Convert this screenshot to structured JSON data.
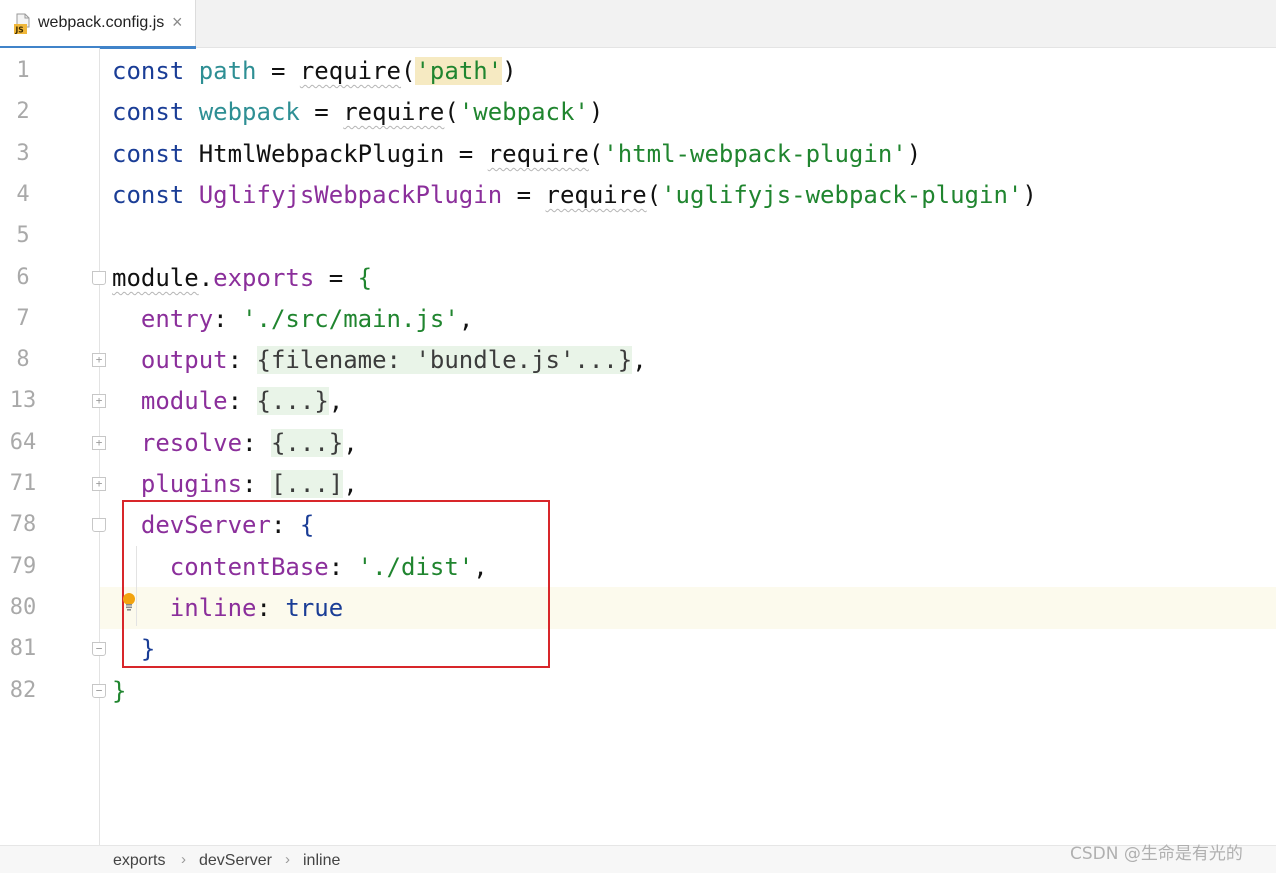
{
  "tab": {
    "filename": "webpack.config.js",
    "close_glyph": "×",
    "icon": "js-file-icon"
  },
  "lines": [
    {
      "no": "1",
      "tokens": [
        [
          "const",
          "kw"
        ],
        [
          " ",
          "plain"
        ],
        [
          "path",
          "var"
        ],
        [
          " = ",
          "plain"
        ],
        [
          "require",
          "req"
        ],
        [
          "(",
          "plain"
        ],
        [
          "'path'",
          "str-hl"
        ],
        [
          ")",
          "plain"
        ]
      ]
    },
    {
      "no": "2",
      "tokens": [
        [
          "const",
          "kw"
        ],
        [
          " ",
          "plain"
        ],
        [
          "webpack",
          "var"
        ],
        [
          " = ",
          "plain"
        ],
        [
          "require",
          "req"
        ],
        [
          "(",
          "plain"
        ],
        [
          "'webpack'",
          "str"
        ],
        [
          ")",
          "plain"
        ]
      ]
    },
    {
      "no": "3",
      "tokens": [
        [
          "const",
          "kw"
        ],
        [
          " HtmlWebpackPlugin = ",
          "plain"
        ],
        [
          "require",
          "req"
        ],
        [
          "(",
          "plain"
        ],
        [
          "'html-webpack-plugin'",
          "str"
        ],
        [
          ")",
          "plain"
        ]
      ]
    },
    {
      "no": "4",
      "tokens": [
        [
          "const",
          "kw"
        ],
        [
          " ",
          "plain"
        ],
        [
          "UglifyjsWebpackPlugin",
          "cls"
        ],
        [
          " = ",
          "plain"
        ],
        [
          "require",
          "req"
        ],
        [
          "(",
          "plain"
        ],
        [
          "'uglifyjs-webpack-plugin'",
          "str"
        ],
        [
          ")",
          "plain"
        ]
      ]
    },
    {
      "no": "5",
      "tokens": []
    },
    {
      "no": "6",
      "tokens": [
        [
          "module",
          "module"
        ],
        [
          ".",
          "plain"
        ],
        [
          "exports",
          "exports"
        ],
        [
          " = ",
          "plain"
        ],
        [
          "{",
          "brace"
        ]
      ]
    },
    {
      "no": "7",
      "tokens": [
        [
          "  ",
          "plain"
        ],
        [
          "entry",
          "prop"
        ],
        [
          ": ",
          "plain"
        ],
        [
          "'./src/main.js'",
          "str"
        ],
        [
          ",",
          "plain"
        ]
      ]
    },
    {
      "no": "8",
      "tokens": [
        [
          "  ",
          "plain"
        ],
        [
          "output",
          "prop"
        ],
        [
          ": ",
          "plain"
        ],
        [
          "{filename: 'bundle.js'...}",
          "fold"
        ],
        [
          ",",
          "plain"
        ]
      ]
    },
    {
      "no": "13",
      "tokens": [
        [
          "  ",
          "plain"
        ],
        [
          "module",
          "prop"
        ],
        [
          ": ",
          "plain"
        ],
        [
          "{...}",
          "fold"
        ],
        [
          ",",
          "plain"
        ]
      ]
    },
    {
      "no": "64",
      "tokens": [
        [
          "  ",
          "plain"
        ],
        [
          "resolve",
          "prop"
        ],
        [
          ": ",
          "plain"
        ],
        [
          "{...}",
          "fold"
        ],
        [
          ",",
          "plain"
        ]
      ]
    },
    {
      "no": "71",
      "tokens": [
        [
          "  ",
          "plain"
        ],
        [
          "plugins",
          "prop"
        ],
        [
          ": ",
          "plain"
        ],
        [
          "[...]",
          "fold"
        ],
        [
          ",",
          "plain"
        ]
      ]
    },
    {
      "no": "78",
      "tokens": [
        [
          "  ",
          "plain"
        ],
        [
          "devServer",
          "prop"
        ],
        [
          ": ",
          "plain"
        ],
        [
          "{",
          "brace-b"
        ]
      ]
    },
    {
      "no": "79",
      "tokens": [
        [
          "    ",
          "plain"
        ],
        [
          "contentBase",
          "prop"
        ],
        [
          ": ",
          "plain"
        ],
        [
          "'./dist'",
          "str"
        ],
        [
          ",",
          "plain"
        ]
      ]
    },
    {
      "no": "80",
      "tokens": [
        [
          "    ",
          "plain"
        ],
        [
          "inline",
          "prop"
        ],
        [
          ": ",
          "plain"
        ],
        [
          "true",
          "kw"
        ]
      ]
    },
    {
      "no": "81",
      "tokens": [
        [
          "  ",
          "plain"
        ],
        [
          "}",
          "brace-b"
        ]
      ]
    },
    {
      "no": "82",
      "tokens": [
        [
          "}",
          "brace"
        ]
      ]
    }
  ],
  "folds": [
    {
      "line_index": 5,
      "kind": "open-start",
      "glyph": ""
    },
    {
      "line_index": 7,
      "kind": "collapsed",
      "glyph": "+"
    },
    {
      "line_index": 8,
      "kind": "collapsed",
      "glyph": "+"
    },
    {
      "line_index": 9,
      "kind": "collapsed",
      "glyph": "+"
    },
    {
      "line_index": 10,
      "kind": "collapsed",
      "glyph": "+"
    },
    {
      "line_index": 11,
      "kind": "open-start",
      "glyph": ""
    },
    {
      "line_index": 14,
      "kind": "open-end",
      "glyph": "−"
    },
    {
      "line_index": 15,
      "kind": "open-end",
      "glyph": "−"
    }
  ],
  "current_line_index": 13,
  "breadcrumb": [
    "exports",
    "devServer",
    "inline"
  ],
  "breadcrumb_separator": "›",
  "watermark": "CSDN @生命是有光的",
  "colors": {
    "keyword": "#1a3d96",
    "variable": "#2e8f94",
    "property": "#8b2f9b",
    "string": "#20852f",
    "highlight_box": "#d8262a",
    "tab_underline": "#4083c9"
  }
}
